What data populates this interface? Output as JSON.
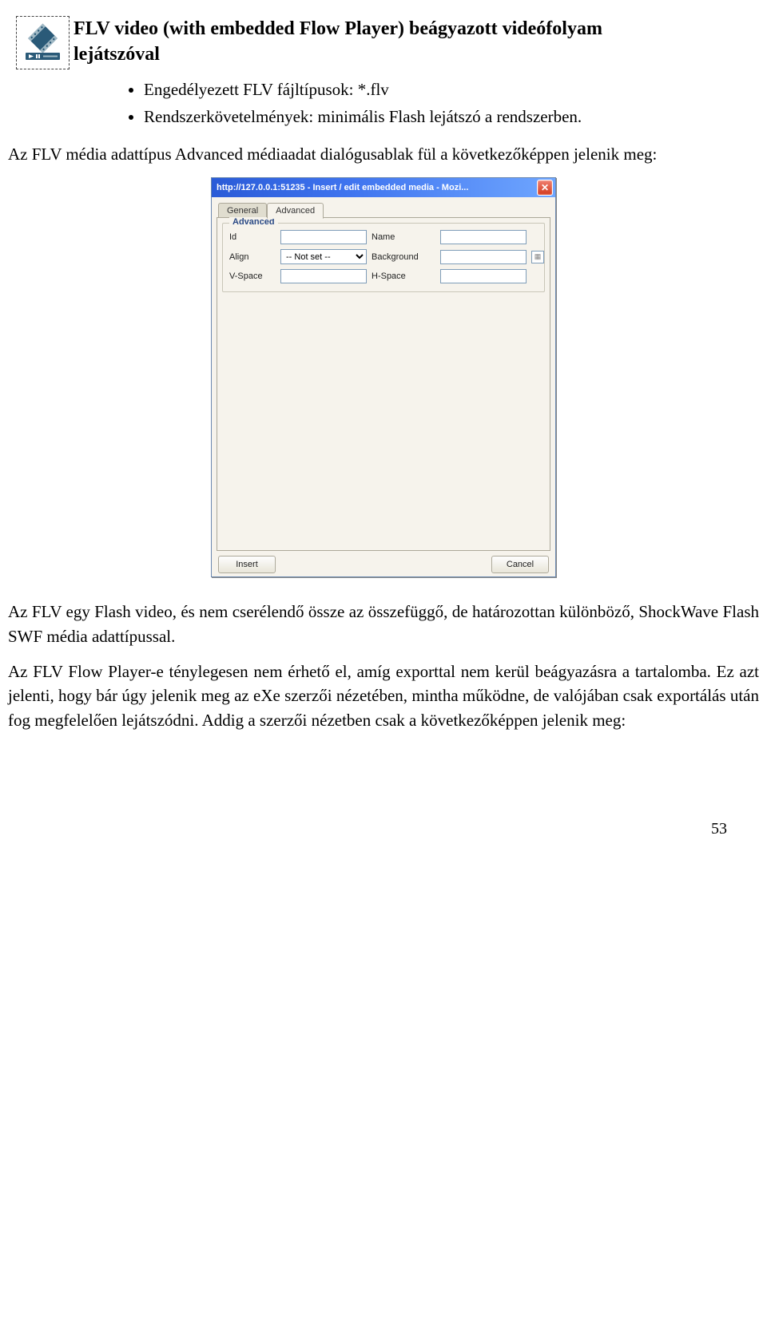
{
  "icon": {
    "name": "flv-video-icon"
  },
  "heading": {
    "line1": "FLV video (with embedded Flow Player) beágyazott videófolyam",
    "line2": "lejátszóval"
  },
  "bullets": [
    "Engedélyezett FLV fájltípusok: *.flv",
    "Rendszerkövetelmények: minimális Flash lejátszó a rendszerben."
  ],
  "para1": "Az FLV média adattípus Advanced médiaadat dialógusablak fül a következőképpen jelenik meg:",
  "dialog": {
    "title": "http://127.0.0.1:51235 - Insert / edit embedded media - Mozi...",
    "tabs": {
      "general": "General",
      "advanced": "Advanced"
    },
    "fieldset_legend": "Advanced",
    "labels": {
      "id": "Id",
      "name": "Name",
      "align": "Align",
      "background": "Background",
      "vspace": "V-Space",
      "hspace": "H-Space"
    },
    "align_value": "-- Not set --",
    "buttons": {
      "insert": "Insert",
      "cancel": "Cancel"
    }
  },
  "para2": "Az FLV egy Flash video, és nem cserélendő össze az összefüggő, de határozottan különböző, ShockWave Flash SWF média adattípussal.",
  "para3": "Az FLV Flow Player-e ténylegesen nem érhető el, amíg exporttal nem kerül beágyazásra a tartalomba. Ez azt jelenti, hogy bár úgy jelenik meg az eXe szerzői nézetében, mintha működne, de valójában csak exportálás után fog megfelelően lejátszódni. Addig a szerzői nézetben csak a következőképpen jelenik meg:",
  "page_number": "53"
}
